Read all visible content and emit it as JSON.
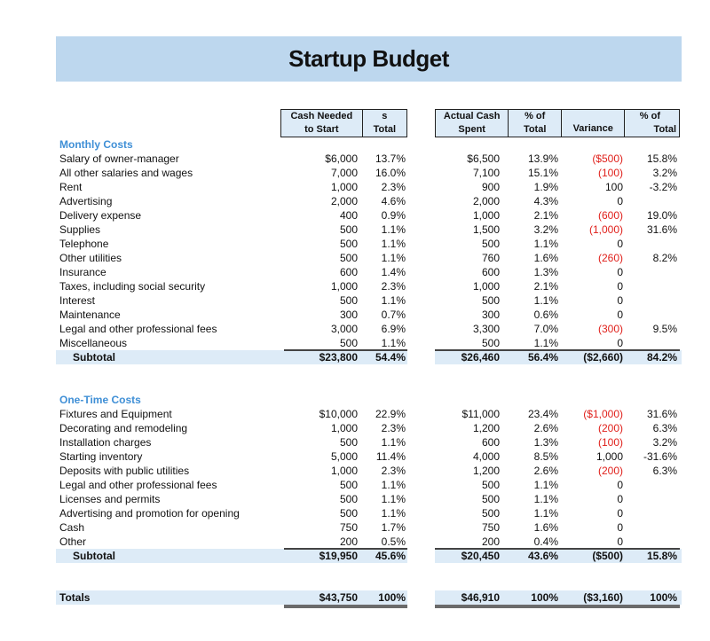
{
  "title": "Startup Budget",
  "headers": {
    "cash_needed": [
      "Cash Needed",
      "to Start"
    ],
    "pct_total_1": [
      "s",
      "Total"
    ],
    "actual_cash": [
      "Actual Cash",
      "Spent"
    ],
    "pct_total_2": [
      "% of",
      "Total"
    ],
    "variance": [
      "",
      "Variance"
    ],
    "pct_total_3": [
      "% of",
      "Total"
    ]
  },
  "monthly": {
    "title": "Monthly Costs",
    "rows": [
      {
        "label": "Salary of owner-manager",
        "needed": "$6,000",
        "pct1": "13.7%",
        "actual": "$6,500",
        "pct2": "13.9%",
        "variance": "($500)",
        "var_neg": true,
        "pct3": "15.8%"
      },
      {
        "label": "All other salaries and wages",
        "needed": "7,000",
        "pct1": "16.0%",
        "actual": "7,100",
        "pct2": "15.1%",
        "variance": "(100)",
        "var_neg": true,
        "pct3": "3.2%"
      },
      {
        "label": "Rent",
        "needed": "1,000",
        "pct1": "2.3%",
        "actual": "900",
        "pct2": "1.9%",
        "variance": "100",
        "var_neg": false,
        "pct3": "-3.2%"
      },
      {
        "label": "Advertising",
        "needed": "2,000",
        "pct1": "4.6%",
        "actual": "2,000",
        "pct2": "4.3%",
        "variance": "0",
        "var_neg": false,
        "pct3": ""
      },
      {
        "label": "Delivery expense",
        "needed": "400",
        "pct1": "0.9%",
        "actual": "1,000",
        "pct2": "2.1%",
        "variance": "(600)",
        "var_neg": true,
        "pct3": "19.0%"
      },
      {
        "label": "Supplies",
        "needed": "500",
        "pct1": "1.1%",
        "actual": "1,500",
        "pct2": "3.2%",
        "variance": "(1,000)",
        "var_neg": true,
        "pct3": "31.6%"
      },
      {
        "label": "Telephone",
        "needed": "500",
        "pct1": "1.1%",
        "actual": "500",
        "pct2": "1.1%",
        "variance": "0",
        "var_neg": false,
        "pct3": ""
      },
      {
        "label": "Other utilities",
        "needed": "500",
        "pct1": "1.1%",
        "actual": "760",
        "pct2": "1.6%",
        "variance": "(260)",
        "var_neg": true,
        "pct3": "8.2%"
      },
      {
        "label": "Insurance",
        "needed": "600",
        "pct1": "1.4%",
        "actual": "600",
        "pct2": "1.3%",
        "variance": "0",
        "var_neg": false,
        "pct3": ""
      },
      {
        "label": "Taxes, including social security",
        "needed": "1,000",
        "pct1": "2.3%",
        "actual": "1,000",
        "pct2": "2.1%",
        "variance": "0",
        "var_neg": false,
        "pct3": ""
      },
      {
        "label": "Interest",
        "needed": "500",
        "pct1": "1.1%",
        "actual": "500",
        "pct2": "1.1%",
        "variance": "0",
        "var_neg": false,
        "pct3": ""
      },
      {
        "label": "Maintenance",
        "needed": "300",
        "pct1": "0.7%",
        "actual": "300",
        "pct2": "0.6%",
        "variance": "0",
        "var_neg": false,
        "pct3": ""
      },
      {
        "label": "Legal and other professional fees",
        "needed": "3,000",
        "pct1": "6.9%",
        "actual": "3,300",
        "pct2": "7.0%",
        "variance": "(300)",
        "var_neg": true,
        "pct3": "9.5%"
      },
      {
        "label": "Miscellaneous",
        "needed": "500",
        "pct1": "1.1%",
        "actual": "500",
        "pct2": "1.1%",
        "variance": "0",
        "var_neg": false,
        "pct3": ""
      }
    ],
    "subtotal": {
      "label": "Subtotal",
      "needed": "$23,800",
      "pct1": "54.4%",
      "actual": "$26,460",
      "pct2": "56.4%",
      "variance": "($2,660)",
      "pct3": "84.2%"
    }
  },
  "onetime": {
    "title": "One-Time Costs",
    "rows": [
      {
        "label": "Fixtures and Equipment",
        "needed": "$10,000",
        "pct1": "22.9%",
        "actual": "$11,000",
        "pct2": "23.4%",
        "variance": "($1,000)",
        "var_neg": true,
        "pct3": "31.6%"
      },
      {
        "label": "Decorating and remodeling",
        "needed": "1,000",
        "pct1": "2.3%",
        "actual": "1,200",
        "pct2": "2.6%",
        "variance": "(200)",
        "var_neg": true,
        "pct3": "6.3%"
      },
      {
        "label": "Installation charges",
        "needed": "500",
        "pct1": "1.1%",
        "actual": "600",
        "pct2": "1.3%",
        "variance": "(100)",
        "var_neg": true,
        "pct3": "3.2%"
      },
      {
        "label": "Starting inventory",
        "needed": "5,000",
        "pct1": "11.4%",
        "actual": "4,000",
        "pct2": "8.5%",
        "variance": "1,000",
        "var_neg": false,
        "pct3": "-31.6%"
      },
      {
        "label": "Deposits with public utilities",
        "needed": "1,000",
        "pct1": "2.3%",
        "actual": "1,200",
        "pct2": "2.6%",
        "variance": "(200)",
        "var_neg": true,
        "pct3": "6.3%"
      },
      {
        "label": "Legal and other professional fees",
        "needed": "500",
        "pct1": "1.1%",
        "actual": "500",
        "pct2": "1.1%",
        "variance": "0",
        "var_neg": false,
        "pct3": ""
      },
      {
        "label": "Licenses and permits",
        "needed": "500",
        "pct1": "1.1%",
        "actual": "500",
        "pct2": "1.1%",
        "variance": "0",
        "var_neg": false,
        "pct3": ""
      },
      {
        "label": "Advertising and promotion for opening",
        "needed": "500",
        "pct1": "1.1%",
        "actual": "500",
        "pct2": "1.1%",
        "variance": "0",
        "var_neg": false,
        "pct3": ""
      },
      {
        "label": "Cash",
        "needed": "750",
        "pct1": "1.7%",
        "actual": "750",
        "pct2": "1.6%",
        "variance": "0",
        "var_neg": false,
        "pct3": ""
      },
      {
        "label": "Other",
        "needed": "200",
        "pct1": "0.5%",
        "actual": "200",
        "pct2": "0.4%",
        "variance": "0",
        "var_neg": false,
        "pct3": ""
      }
    ],
    "subtotal": {
      "label": "Subtotal",
      "needed": "$19,950",
      "pct1": "45.6%",
      "actual": "$20,450",
      "pct2": "43.6%",
      "variance": "($500)",
      "pct3": "15.8%"
    }
  },
  "totals": {
    "label": "Totals",
    "needed": "$43,750",
    "pct1": "100%",
    "actual": "$46,910",
    "pct2": "100%",
    "variance": "($3,160)",
    "pct3": "100%"
  },
  "colors": {
    "title_band": "#bdd7ee",
    "header_fill": "#ddebf7",
    "section_title": "#3f8fd6",
    "negative": "#e0201b"
  }
}
